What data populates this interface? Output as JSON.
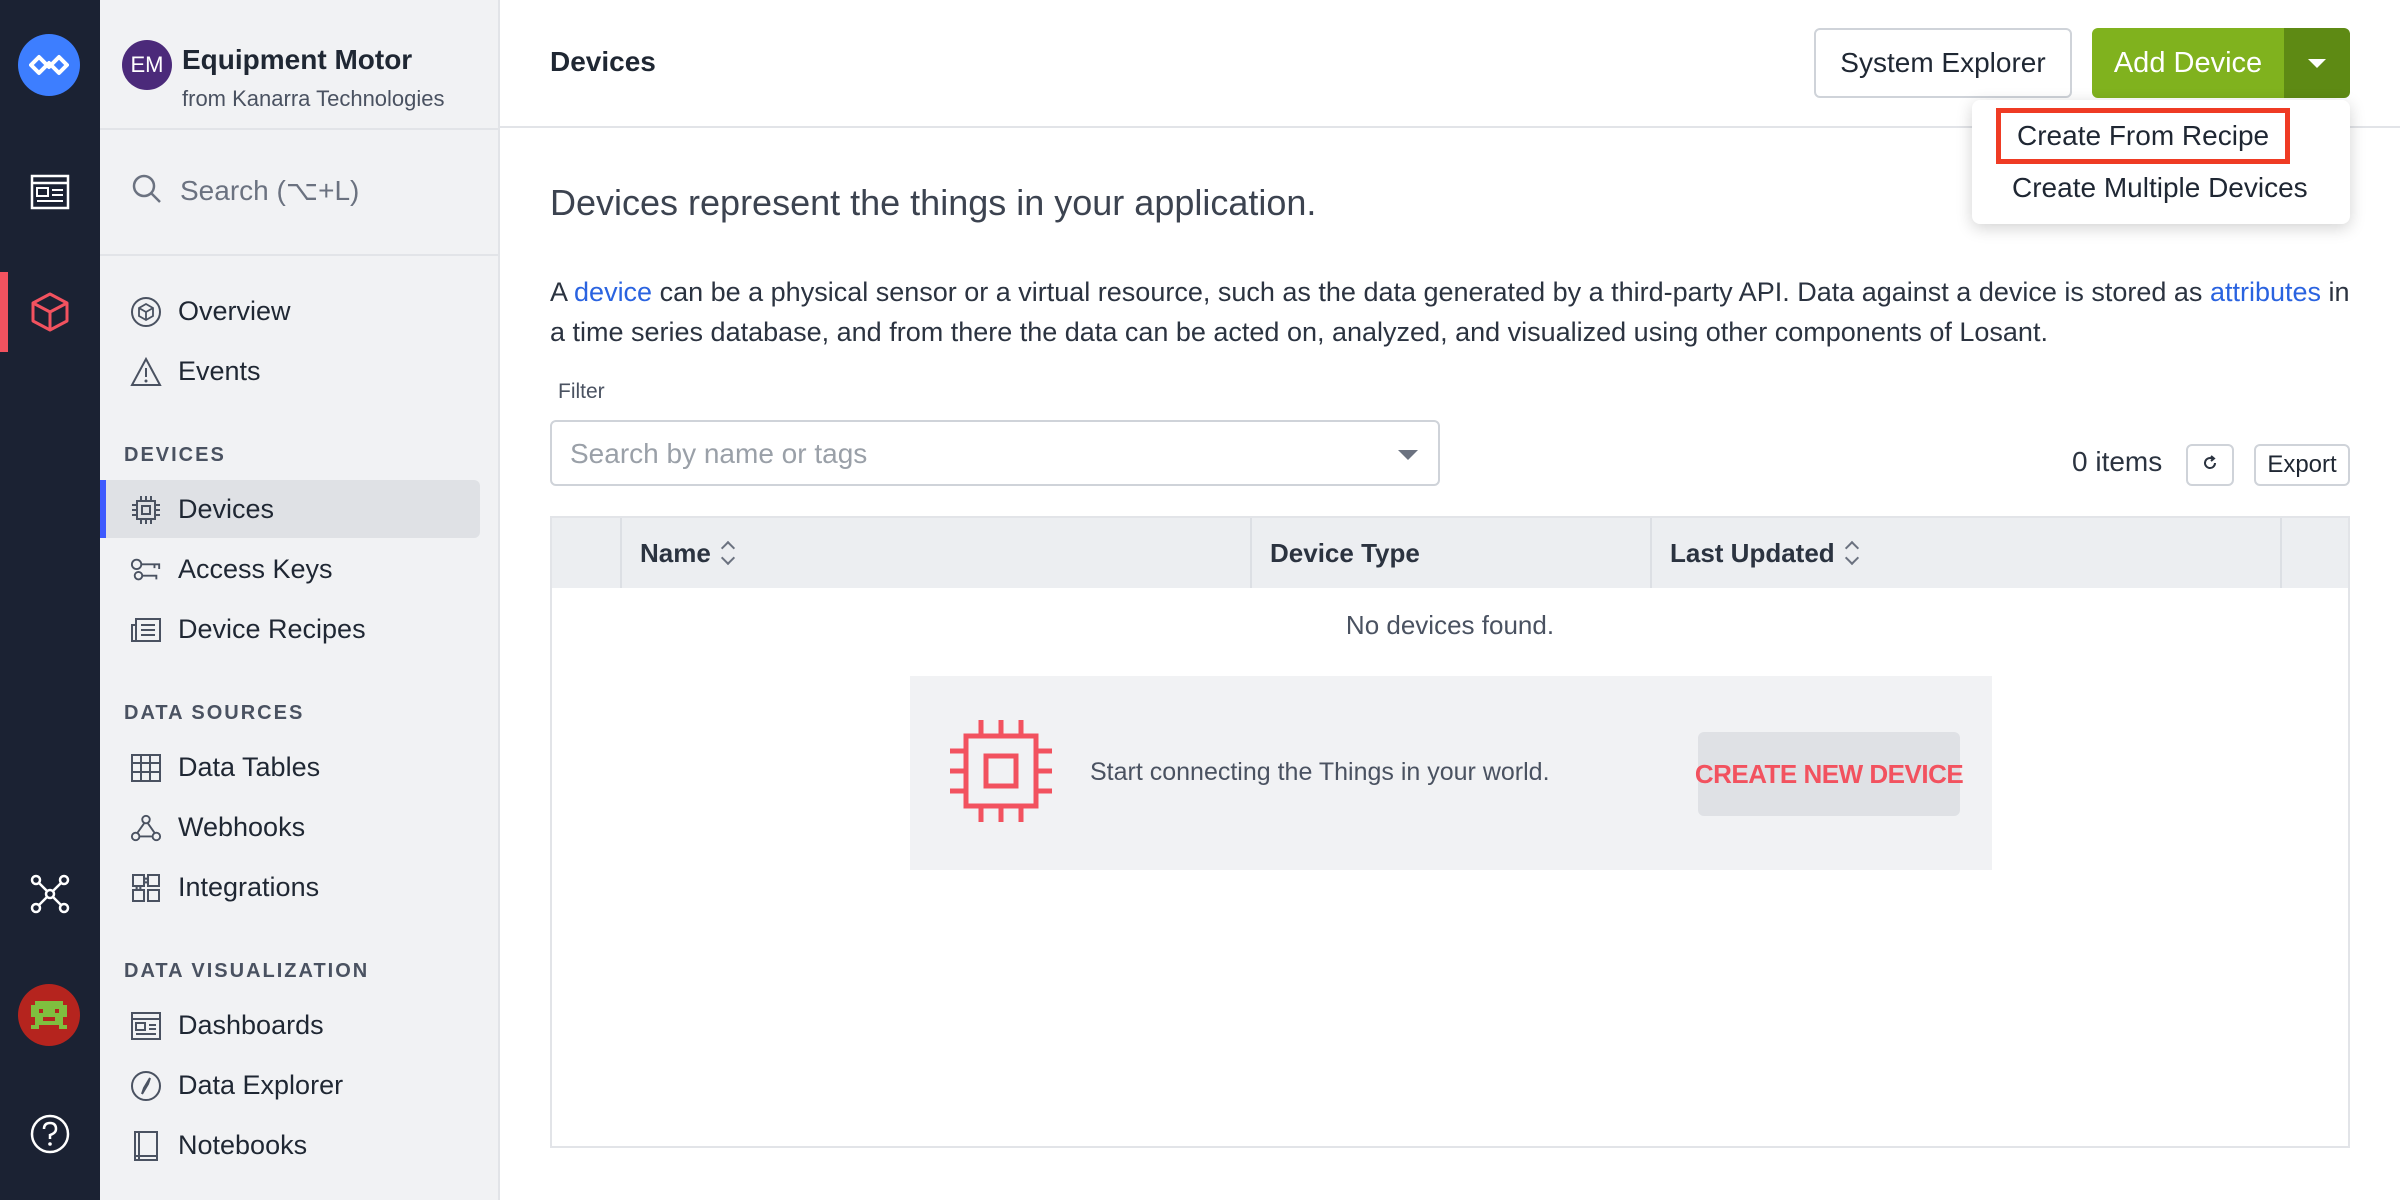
{
  "app": {
    "initials": "EM",
    "name": "Equipment Motor",
    "org": "from Kanarra Technologies"
  },
  "sidebar": {
    "search_placeholder": "Search (⌥+L)",
    "top_items": [
      {
        "label": "Overview",
        "icon": "cube-outline-icon"
      },
      {
        "label": "Events",
        "icon": "warning-triangle-icon"
      }
    ],
    "sections": [
      {
        "title": "DEVICES",
        "items": [
          {
            "label": "Devices",
            "icon": "chip-icon",
            "active": true
          },
          {
            "label": "Access Keys",
            "icon": "keys-icon"
          },
          {
            "label": "Device Recipes",
            "icon": "recipe-icon"
          }
        ]
      },
      {
        "title": "DATA SOURCES",
        "items": [
          {
            "label": "Data Tables",
            "icon": "table-grid-icon"
          },
          {
            "label": "Webhooks",
            "icon": "webhook-icon"
          },
          {
            "label": "Integrations",
            "icon": "puzzle-icon"
          }
        ]
      },
      {
        "title": "DATA VISUALIZATION",
        "items": [
          {
            "label": "Dashboards",
            "icon": "dashboard-icon"
          },
          {
            "label": "Data Explorer",
            "icon": "compass-icon"
          },
          {
            "label": "Notebooks",
            "icon": "notebook-icon"
          }
        ]
      }
    ]
  },
  "rail": {
    "icons": [
      "losant-logo-icon",
      "dashboard-icon",
      "cube-icon",
      "network-icon",
      "user-avatar",
      "help-icon"
    ]
  },
  "header": {
    "title": "Devices",
    "system_explorer_label": "System Explorer",
    "add_device_label": "Add Device"
  },
  "dropdown": {
    "items": [
      "Create From Recipe",
      "Create Multiple Devices"
    ]
  },
  "main": {
    "intro": "Devices represent the things in your application.",
    "desc_1": "A ",
    "desc_link_1": "device",
    "desc_2": " can be a physical sensor or a virtual resource, such as the data generated by a third-party API. Data against a device is stored as ",
    "desc_link_2": "attributes",
    "desc_3": " in a time series database, and from there the data can be acted on, analyzed, and visualized using other components of Losant.",
    "filter_label": "Filter",
    "filter_placeholder": "Search by name or tags",
    "count": "0 items",
    "export_label": "Export"
  },
  "table": {
    "columns": [
      "Name",
      "Device Type",
      "Last Updated"
    ],
    "empty_text": "No devices found.",
    "empty_prompt": "Start connecting the Things in your world.",
    "create_label": "CREATE NEW DEVICE"
  },
  "colors": {
    "accent_green": "#80b21e",
    "accent_red": "#f2525f",
    "link_blue": "#2a63e0",
    "rail_bg": "#1b2233"
  }
}
